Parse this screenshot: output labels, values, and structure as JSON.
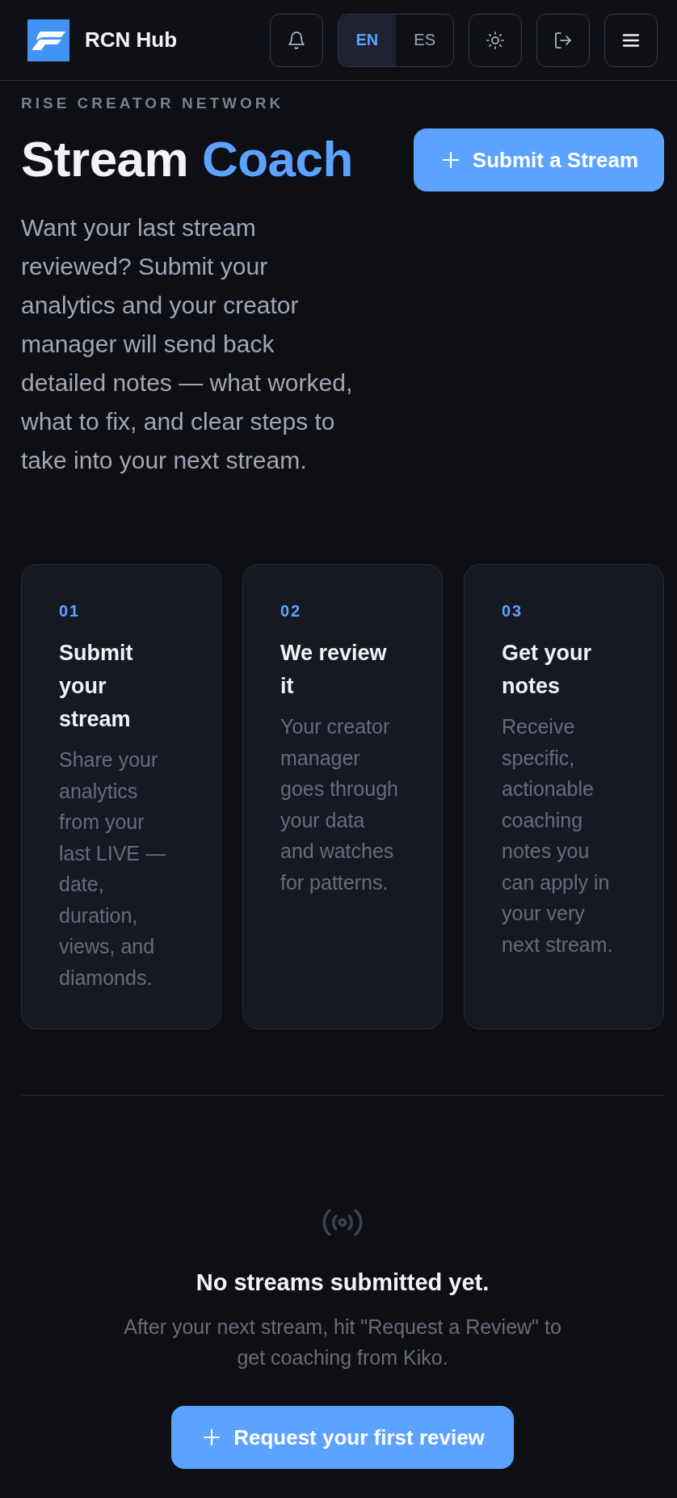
{
  "header": {
    "brand": "RCN Hub",
    "languages": [
      {
        "label": "EN",
        "selected": true
      },
      {
        "label": "ES",
        "selected": false
      }
    ]
  },
  "hero": {
    "eyebrow": "RISE CREATOR NETWORK",
    "title": "Stream",
    "title_accent": "Coach",
    "description": "Want your last stream reviewed? Submit your analytics and your creator manager will send back detailed notes — what worked, what to fix, and clear steps to take into your next stream.",
    "button": "Submit a Stream"
  },
  "steps": [
    {
      "number": "01",
      "title": "Submit your stream",
      "description": "Share your analytics from your last LIVE — date, duration, views, and diamonds."
    },
    {
      "number": "02",
      "title": "We review it",
      "description": "Your creator manager goes through your data and watches for patterns."
    },
    {
      "number": "03",
      "title": "Get your notes",
      "description": "Receive specific, actionable coaching notes you can apply in your very next stream."
    }
  ],
  "empty_state": {
    "title": "No streams submitted yet.",
    "message": "After your next stream, hit \"Request a Review\" to get coaching from Kiko.",
    "button": "Request your first review"
  }
}
